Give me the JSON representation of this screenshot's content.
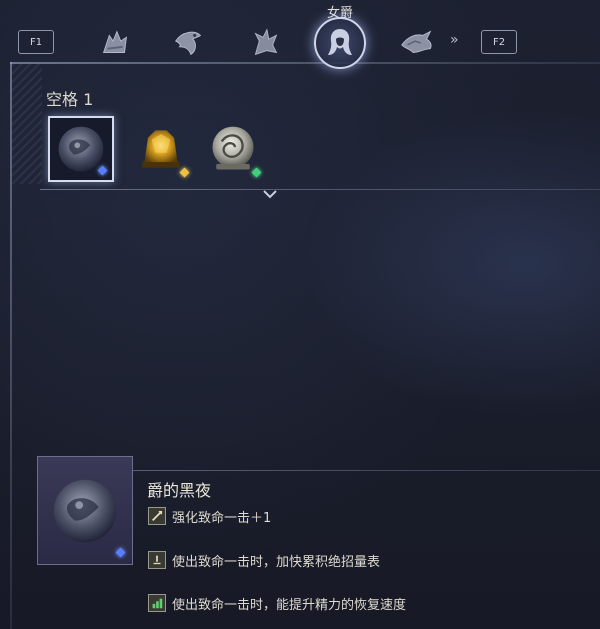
{
  "nav": {
    "prev_key": "F1",
    "next_key": "F2",
    "active_tab_title": "女爵",
    "tabs": [
      {
        "icon": "warrior-icon"
      },
      {
        "icon": "eagle-icon"
      },
      {
        "icon": "beast-icon"
      },
      {
        "icon": "duchess-icon",
        "active": true
      },
      {
        "icon": "wolf-icon"
      }
    ],
    "more": "»"
  },
  "slot": {
    "label": "空格 1",
    "items": [
      {
        "icon": "dark-orb-relic-icon",
        "selected": true,
        "gem_color": "#5a7cff"
      },
      {
        "icon": "golden-relic-icon",
        "selected": false,
        "gem_color": "#f0c040"
      },
      {
        "icon": "dragon-relic-icon",
        "selected": false,
        "gem_color": "#3fd07a"
      }
    ]
  },
  "detail": {
    "title": "爵的黑夜",
    "effects": [
      {
        "icon": "attack-effect-icon",
        "text": "强化致命一击＋1"
      },
      {
        "icon": "gauge-effect-icon",
        "text": "使出致命一击时，加快累积绝招量表"
      },
      {
        "icon": "stamina-effect-icon",
        "text": "使出致命一击时，能提升精力的恢复速度"
      }
    ]
  }
}
